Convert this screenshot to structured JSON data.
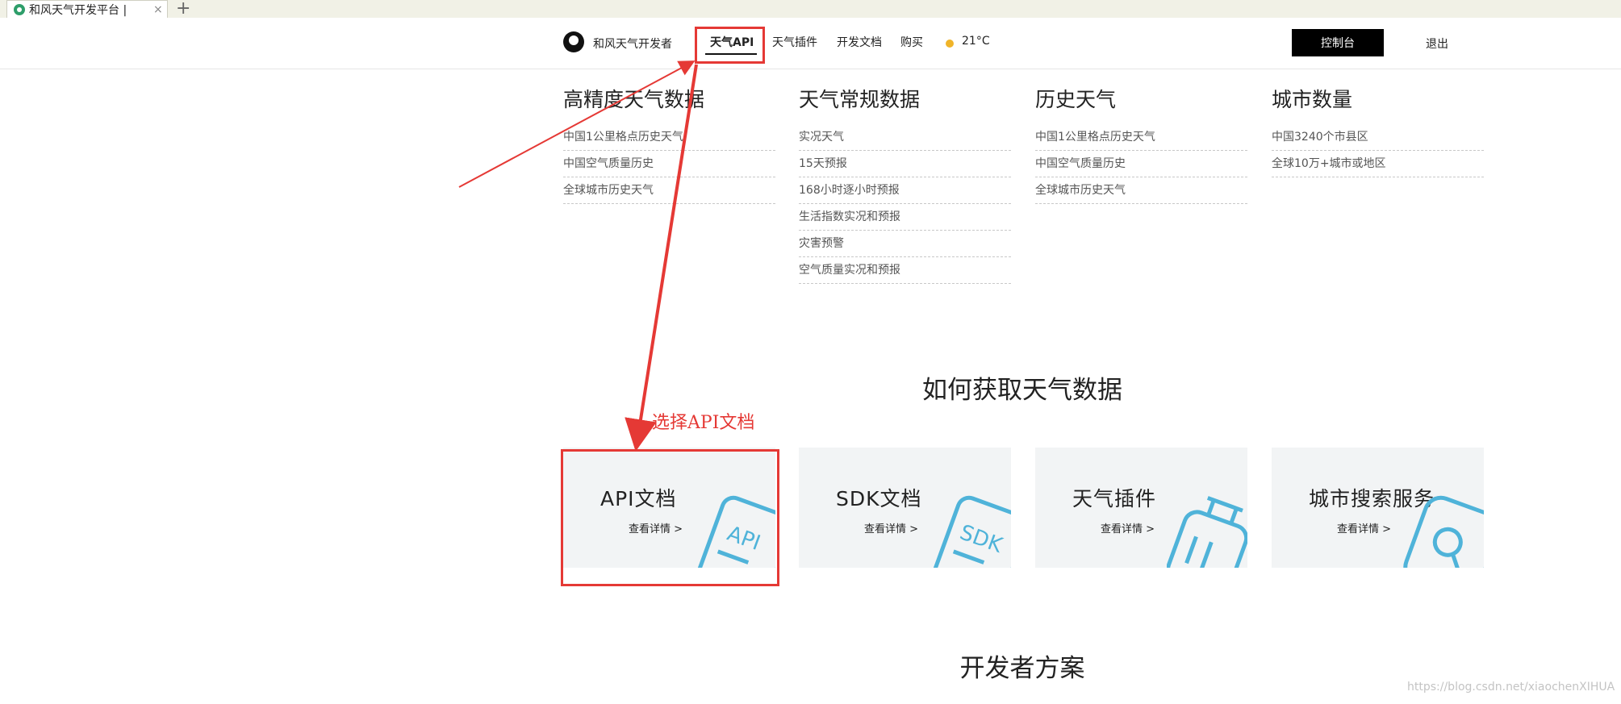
{
  "browser": {
    "tab_title": "和风天气开发平台 |",
    "tab_close": "×",
    "new_tab": "+"
  },
  "header": {
    "brand": "和风天气开发者",
    "nav": [
      "天气API",
      "天气插件",
      "开发文档",
      "购买"
    ],
    "temperature": "21°C",
    "console_button": "控制台",
    "logout": "退出"
  },
  "menu": {
    "columns": [
      {
        "title": "高精度天气数据",
        "items": [
          "中国1公里格点历史天气",
          "中国空气质量历史",
          "全球城市历史天气"
        ]
      },
      {
        "title": "天气常规数据",
        "items": [
          "实况天气",
          "15天预报",
          "168小时逐小时预报",
          "生活指数实况和预报",
          "灾害预警",
          "空气质量实况和预报"
        ]
      },
      {
        "title": "历史天气",
        "items": [
          "中国1公里格点历史天气",
          "中国空气质量历史",
          "全球城市历史天气"
        ]
      },
      {
        "title": "城市数量",
        "items": [
          "中国3240个市县区",
          "全球10万+城市或地区"
        ]
      }
    ]
  },
  "how_to": {
    "title": "如何获取天气数据",
    "cards": [
      {
        "title": "API文档",
        "link": "查看详情 >",
        "icon": "api-doc-icon",
        "icon_text": "API"
      },
      {
        "title": "SDK文档",
        "link": "查看详情 >",
        "icon": "sdk-doc-icon",
        "icon_text": "SDK"
      },
      {
        "title": "天气插件",
        "link": "查看详情 >",
        "icon": "plugin-icon",
        "icon_text": ""
      },
      {
        "title": "城市搜索服务",
        "link": "查看详情 >",
        "icon": "search-icon",
        "icon_text": ""
      }
    ]
  },
  "developer_section": {
    "title": "开发者方案"
  },
  "annotation": {
    "label": "选择API文档",
    "color": "#e53935"
  },
  "watermark": "https://blog.csdn.net/xiaochenXIHUA",
  "colors": {
    "accent_blue": "#4fb3d9",
    "card_bg": "#f2f4f5",
    "sun": "#f0b429"
  }
}
